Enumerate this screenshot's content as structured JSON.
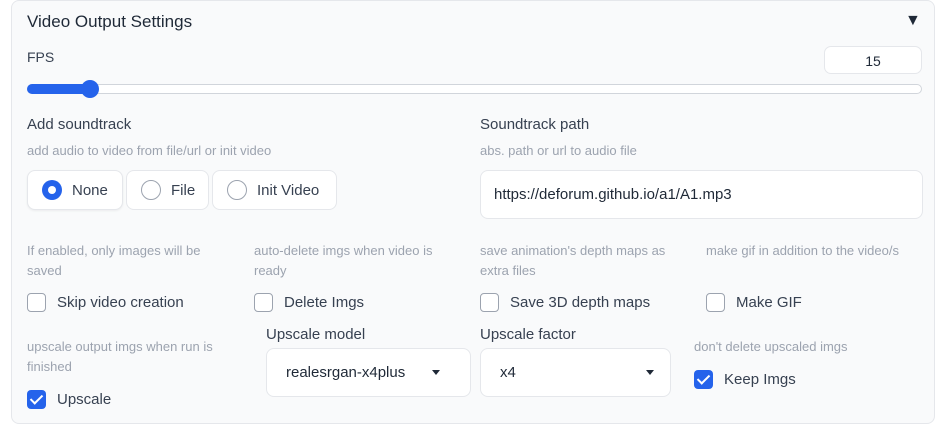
{
  "section": {
    "title": "Video Output Settings",
    "collapse_icon": "triangle-down-icon"
  },
  "fps": {
    "label": "FPS",
    "value": "15",
    "slider_fraction": 0.07
  },
  "soundtrack": {
    "label": "Add soundtrack",
    "hint": "add audio to video from file/url or init video",
    "options": [
      {
        "label": "None",
        "selected": true
      },
      {
        "label": "File",
        "selected": false
      },
      {
        "label": "Init Video",
        "selected": false
      }
    ]
  },
  "soundtrack_path": {
    "label": "Soundtrack path",
    "hint": "abs. path or url to audio file",
    "value": "https://deforum.github.io/a1/A1.mp3"
  },
  "skip_video": {
    "hint": "If enabled, only images will be saved",
    "label": "Skip video creation",
    "checked": false
  },
  "delete_imgs": {
    "hint": "auto-delete imgs when video is ready",
    "label": "Delete Imgs",
    "checked": false
  },
  "save_depth": {
    "hint": "save animation's depth maps as extra files",
    "label": "Save 3D depth maps",
    "checked": false
  },
  "make_gif": {
    "hint": "make gif in addition to the video/s",
    "label": "Make GIF",
    "checked": false
  },
  "upscale": {
    "hint": "upscale output imgs when run is finished",
    "label": "Upscale",
    "checked": true
  },
  "upscale_model": {
    "label": "Upscale model",
    "value": "realesrgan-x4plus"
  },
  "upscale_factor": {
    "label": "Upscale factor",
    "value": "x4"
  },
  "keep_imgs": {
    "hint": "don't delete upscaled imgs",
    "label": "Keep Imgs",
    "checked": true
  },
  "colors": {
    "accent": "#2563eb",
    "panel_bg": "#f9fafb",
    "border": "#e5e7eb",
    "hint_text": "#9ca3af"
  }
}
